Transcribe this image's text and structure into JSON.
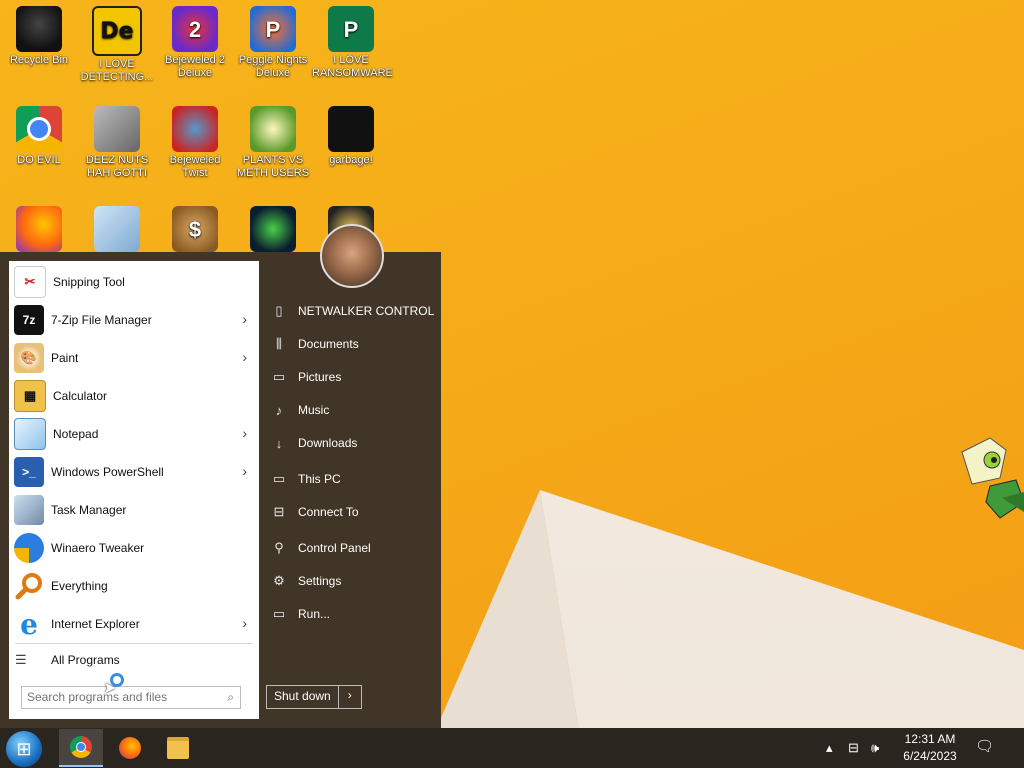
{
  "desktop": {
    "icons": [
      {
        "label": "Recycle Bin",
        "icon": "recycle-bin-icon"
      },
      {
        "label": "I LOVE DETECTING...",
        "icon": "de-app-icon"
      },
      {
        "label": "Bejeweled 2 Deluxe",
        "icon": "bejeweled2-icon"
      },
      {
        "label": "Peggle Nights Deluxe",
        "icon": "peggle-icon"
      },
      {
        "label": "I LOVE RANSOMWARE",
        "icon": "publisher-icon"
      },
      {
        "label": "DO EVIL",
        "icon": "chrome-icon"
      },
      {
        "label": "DEEZ NUTS HAH GOTTI",
        "icon": "windows-stack-icon"
      },
      {
        "label": "Bejeweled Twist",
        "icon": "bejeweled-twist-icon"
      },
      {
        "label": "PLANTS VS METH USERS",
        "icon": "pvz-icon"
      },
      {
        "label": "garbage!",
        "icon": "garbage-icon"
      }
    ],
    "glyphs": {
      "de": "De",
      "bj2": "2",
      "peg": "P",
      "pub": "P",
      "money": "$"
    }
  },
  "start_menu": {
    "programs": [
      {
        "label": "Snipping Tool",
        "icon": "snipping-tool-icon",
        "has_submenu": false
      },
      {
        "label": "7-Zip File Manager",
        "icon": "7zip-icon",
        "has_submenu": true
      },
      {
        "label": "Paint",
        "icon": "paint-icon",
        "has_submenu": true
      },
      {
        "label": "Calculator",
        "icon": "calculator-icon",
        "has_submenu": false
      },
      {
        "label": "Notepad",
        "icon": "notepad-icon",
        "has_submenu": true
      },
      {
        "label": "Windows PowerShell",
        "icon": "powershell-icon",
        "has_submenu": true
      },
      {
        "label": "Task Manager",
        "icon": "task-manager-icon",
        "has_submenu": false
      },
      {
        "label": "Winaero Tweaker",
        "icon": "winaero-icon",
        "has_submenu": false
      },
      {
        "label": "Everything",
        "icon": "everything-search-icon",
        "has_submenu": false
      },
      {
        "label": "Internet Explorer",
        "icon": "internet-explorer-icon",
        "has_submenu": true
      }
    ],
    "prog_glyphs": {
      "7zip": "7z",
      "powershell": ">_",
      "ie": "e"
    },
    "submenu_arrow": "›",
    "all_programs": "All Programs",
    "search": {
      "placeholder": "Search programs and files",
      "value": ""
    },
    "right_items": [
      {
        "label": "NETWALKER CONTROL",
        "icon": "user-folder-icon"
      },
      {
        "label": "Documents",
        "icon": "documents-icon"
      },
      {
        "label": "Pictures",
        "icon": "pictures-icon"
      },
      {
        "label": "Music",
        "icon": "music-icon"
      },
      {
        "label": "Downloads",
        "icon": "downloads-icon"
      },
      {
        "label": "This PC",
        "icon": "this-pc-icon"
      },
      {
        "label": "Connect To",
        "icon": "connect-to-icon"
      },
      {
        "label": "Control Panel",
        "icon": "control-panel-icon"
      },
      {
        "label": "Settings",
        "icon": "settings-gear-icon"
      },
      {
        "label": "Run...",
        "icon": "run-icon"
      }
    ],
    "shutdown": {
      "label": "Shut down",
      "arrow": "›"
    }
  },
  "taskbar": {
    "apps": [
      {
        "name": "Google Chrome",
        "icon": "chrome-icon",
        "active": true
      },
      {
        "name": "Firefox",
        "icon": "firefox-icon",
        "active": false
      },
      {
        "name": "File Explorer",
        "icon": "folder-icon",
        "active": false
      }
    ],
    "clock": {
      "time": "12:31 AM",
      "date": "6/24/2023"
    }
  }
}
